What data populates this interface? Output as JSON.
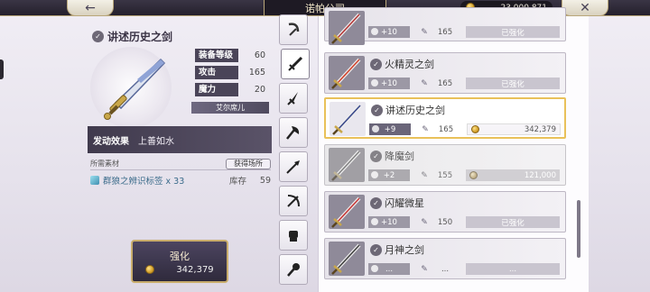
{
  "header": {
    "title": "诺帕公司",
    "gold": "23,000,871"
  },
  "item": {
    "name": "讲述历史之剑",
    "stats": [
      {
        "label": "装备等级",
        "value": "60"
      },
      {
        "label": "攻击",
        "value": "165"
      },
      {
        "label": "魔力",
        "value": "20"
      }
    ],
    "owner": "艾尔席儿",
    "effect_label": "发动效果",
    "effect_value": "上善如水",
    "materials_label": "所需素材",
    "source_button": "获得场所",
    "material": {
      "name": "群狼之辨识标签 x 33",
      "stock_label": "库存",
      "stock": "59"
    }
  },
  "enhance": {
    "label": "强化",
    "cost": "342,379"
  },
  "tabs": [
    "bow-tab",
    "sword-tab",
    "dagger-tab",
    "axe-tab",
    "spear-tab",
    "crossbow-tab",
    "gauntlet-tab",
    "mace-tab"
  ],
  "weapons": [
    {
      "name": "",
      "level": "+10",
      "atk": "165",
      "status": "已强化",
      "selected": false,
      "disabled": false,
      "color": "#b43a3a"
    },
    {
      "name": "火精灵之剑",
      "level": "+10",
      "atk": "165",
      "status": "已强化",
      "selected": false,
      "disabled": false,
      "color": "#d0452f"
    },
    {
      "name": "讲述历史之剑",
      "level": "+9",
      "atk": "165",
      "status": "342,379",
      "selected": true,
      "disabled": false,
      "color": "#3c4a8c"
    },
    {
      "name": "降魔剑",
      "level": "+2",
      "atk": "155",
      "status": "121,000",
      "selected": false,
      "disabled": true,
      "color": "#6a6a6a"
    },
    {
      "name": "闪耀微星",
      "level": "+10",
      "atk": "150",
      "status": "已强化",
      "selected": false,
      "disabled": false,
      "color": "#c53a3a"
    },
    {
      "name": "月神之剑",
      "level": "...",
      "atk": "...",
      "status": "...",
      "selected": false,
      "disabled": false,
      "color": "#444"
    }
  ]
}
